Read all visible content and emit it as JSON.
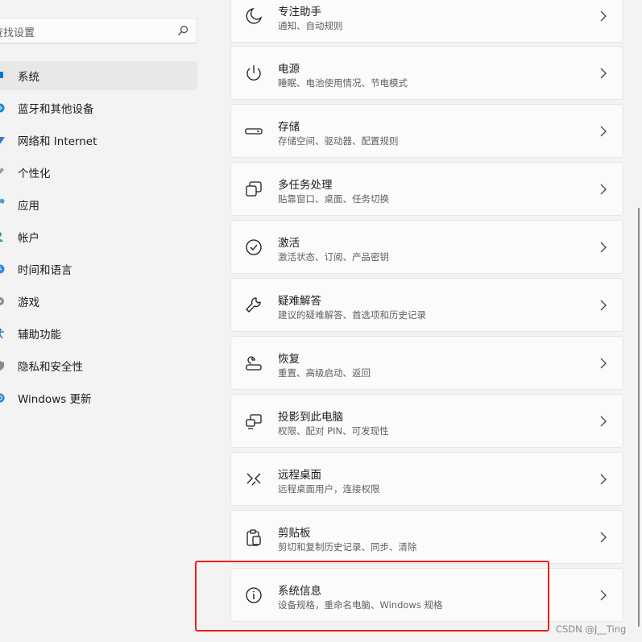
{
  "search": {
    "text": "查找设置"
  },
  "sidebar": {
    "items": [
      {
        "label": "系统",
        "icon": "monitor-icon",
        "selected": true
      },
      {
        "label": "蓝牙和其他设备",
        "icon": "bluetooth-icon"
      },
      {
        "label": "网络和 Internet",
        "icon": "network-icon"
      },
      {
        "label": "个性化",
        "icon": "brush-icon"
      },
      {
        "label": "应用",
        "icon": "apps-icon"
      },
      {
        "label": "帐户",
        "icon": "account-icon"
      },
      {
        "label": "时间和语言",
        "icon": "globe-clock-icon"
      },
      {
        "label": "游戏",
        "icon": "gamepad-icon"
      },
      {
        "label": "辅助功能",
        "icon": "accessibility-icon"
      },
      {
        "label": "隐私和安全性",
        "icon": "shield-icon"
      },
      {
        "label": "Windows 更新",
        "icon": "update-icon"
      }
    ]
  },
  "main": {
    "items": [
      {
        "title": "专注助手",
        "subtitle": "通知、自动规则",
        "icon": "moon-icon"
      },
      {
        "title": "电源",
        "subtitle": "睡眠、电池使用情况、节电模式",
        "icon": "power-icon"
      },
      {
        "title": "存储",
        "subtitle": "存储空间、驱动器、配置规则",
        "icon": "storage-icon"
      },
      {
        "title": "多任务处理",
        "subtitle": "贴靠窗口、桌面、任务切换",
        "icon": "multitask-icon"
      },
      {
        "title": "激活",
        "subtitle": "激活状态、订阅、产品密钥",
        "icon": "check-circle-icon"
      },
      {
        "title": "疑难解答",
        "subtitle": "建议的疑难解答、首选项和历史记录",
        "icon": "wrench-icon"
      },
      {
        "title": "恢复",
        "subtitle": "重置、高级启动、返回",
        "icon": "recovery-icon"
      },
      {
        "title": "投影到此电脑",
        "subtitle": "权限、配对 PIN、可发现性",
        "icon": "project-icon"
      },
      {
        "title": "远程桌面",
        "subtitle": "远程桌面用户，连接权限",
        "icon": "remote-desktop-icon"
      },
      {
        "title": "剪贴板",
        "subtitle": "剪切和复制历史记录、同步、清除",
        "icon": "clipboard-icon"
      },
      {
        "title": "系统信息",
        "subtitle": "设备规格，重命名电脑、Windows 规格",
        "icon": "info-icon"
      }
    ]
  },
  "watermark": "CSDN @J__Ting",
  "colors": {
    "highlight": "#e8211e",
    "accent": "#0067c0"
  }
}
